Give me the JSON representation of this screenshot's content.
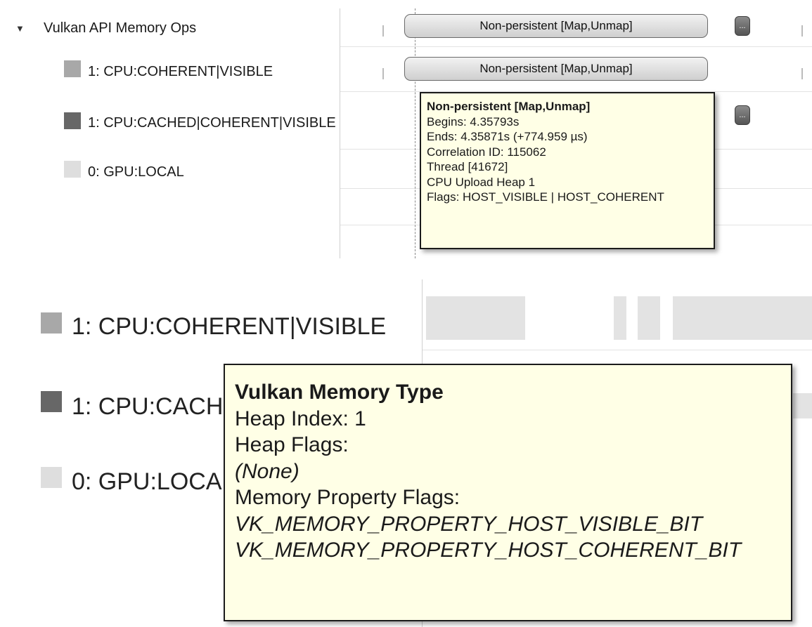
{
  "top": {
    "group": {
      "label": "Vulkan API Memory Ops",
      "expand_glyph": "▼"
    },
    "tree_items": [
      {
        "label": "1: CPU:COHERENT|VISIBLE",
        "swatch_color": "#a8a8a8"
      },
      {
        "label": "1: CPU:CACHED|COHERENT|VISIBLE",
        "swatch_color": "#676767"
      },
      {
        "label": "0: GPU:LOCAL",
        "swatch_color": "#dedede"
      }
    ],
    "timeline": {
      "pill_row1": "Non-persistent [Map,Unmap]",
      "pill_row2": "Non-persistent [Map,Unmap]",
      "more_label": "..."
    },
    "tooltip": {
      "title": "Non-persistent [Map,Unmap]",
      "begins": "Begins: 4.35793s",
      "ends": "Ends: 4.35871s (+774.959 µs)",
      "correlation": "Correlation ID: 115062",
      "thread": "Thread [41672]",
      "heap": "CPU Upload Heap 1",
      "flags": "Flags: HOST_VISIBLE | HOST_COHERENT"
    }
  },
  "bottom": {
    "labels": [
      {
        "text": "1: CPU:COHERENT|VISIBLE",
        "swatch_color": "#a8a8a8"
      },
      {
        "text": "1: CPU:CACH",
        "swatch_color": "#676767"
      },
      {
        "text": "0: GPU:LOCA",
        "swatch_color": "#dedede"
      }
    ],
    "tooltip": {
      "title": "Vulkan Memory Type",
      "heap_index": "Heap Index: 1",
      "heap_flags_label": "Heap Flags:",
      "heap_flags_value": "(None)",
      "mem_props_label": "Memory Property Flags:",
      "mem_prop_1": "VK_MEMORY_PROPERTY_HOST_VISIBLE_BIT",
      "mem_prop_2": "VK_MEMORY_PROPERTY_HOST_COHERENT_BIT"
    }
  }
}
